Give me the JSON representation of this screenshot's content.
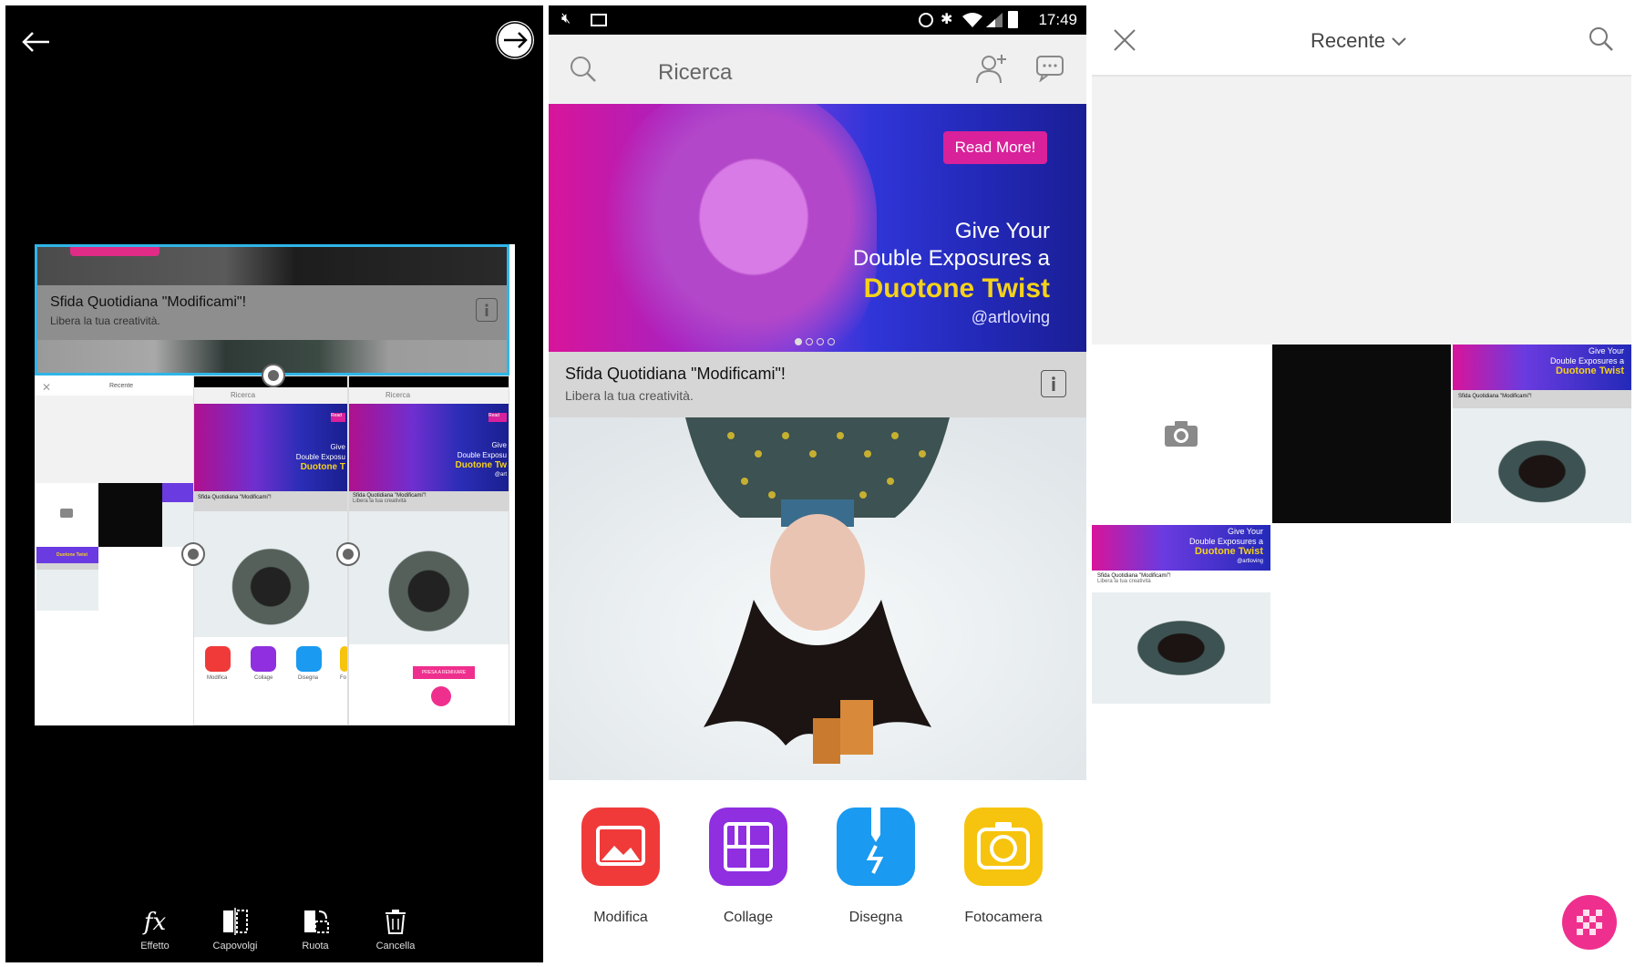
{
  "editor": {
    "collage": {
      "selected_title": "Sfida Quotidiana \"Modificami\"!",
      "selected_subtitle": "Libera la tua creatività.",
      "mini_gallery_title": "Recente",
      "mini_search": "Ricerca",
      "mini_banner_text": [
        "Give",
        "Double Exposu",
        "Duotone T"
      ],
      "mini_banner_text2": [
        "Give",
        "Double Exposu",
        "Duotone Tw",
        "@art"
      ],
      "mini_read": "Read",
      "mini_caption": "Sfida Quotidiana \"Modificami\"!",
      "mini_caption_sub": "Libera la tua creatività",
      "mini_apps": [
        "Modifica",
        "Collage",
        "Disegna",
        "Fo"
      ],
      "mini_button": "PRESA A REMIXARE",
      "mini_thumb_banner": "Duotone Twist"
    },
    "toolbar": [
      {
        "label": "Effetto",
        "icon": "fx-icon"
      },
      {
        "label": "Capovolgi",
        "icon": "flip-icon"
      },
      {
        "label": "Ruota",
        "icon": "rotate-icon"
      },
      {
        "label": "Cancella",
        "icon": "trash-icon"
      }
    ]
  },
  "home": {
    "status": {
      "time": "17:49"
    },
    "search_placeholder": "Ricerca",
    "banner": {
      "button": "Read More!",
      "line1": "Give Your",
      "line2": "Double Exposures a",
      "line3": "Duotone Twist",
      "line4": "@artloving",
      "page_count": 4,
      "active_page": 1
    },
    "caption": {
      "title": "Sfida Quotidiana \"Modificami\"!",
      "subtitle": "Libera la tua creatività."
    },
    "apps": [
      {
        "label": "Modifica",
        "color": "#f03a3a"
      },
      {
        "label": "Collage",
        "color": "#8f2fe0"
      },
      {
        "label": "Disegna",
        "color": "#1a9af0"
      },
      {
        "label": "Fotocamera",
        "color": "#f6c40e"
      }
    ]
  },
  "gallery": {
    "title": "Recente",
    "thumb_banner": {
      "line1": "Give Your",
      "line2": "Double Exposures a",
      "line3": "Duotone Twist",
      "line4": "@artloving",
      "caption": "Sfida Quotidiana \"Modificami\"!",
      "caption_sub": "Libera la tua creatività"
    },
    "accent": "#ef2f8d"
  }
}
